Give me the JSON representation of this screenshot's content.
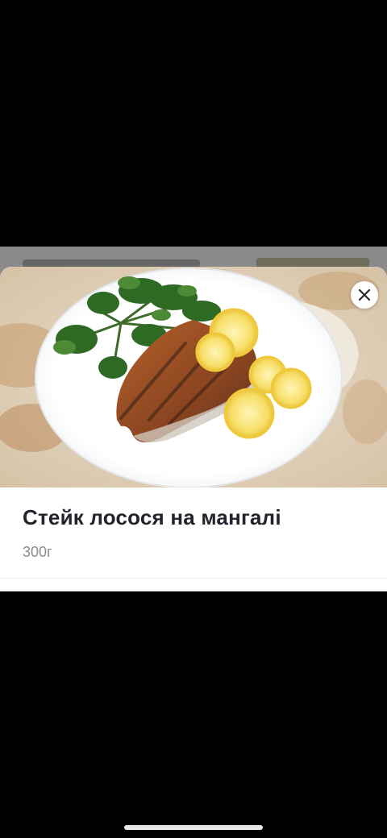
{
  "product": {
    "title": "Стейк лосося на мангалі",
    "weight": "300г",
    "image_alt": "photo"
  },
  "close_icon": "close-icon",
  "colors": {
    "title": "#23232d",
    "weight": "#8b8b93",
    "backdrop_dim": "#8a8a8a"
  }
}
